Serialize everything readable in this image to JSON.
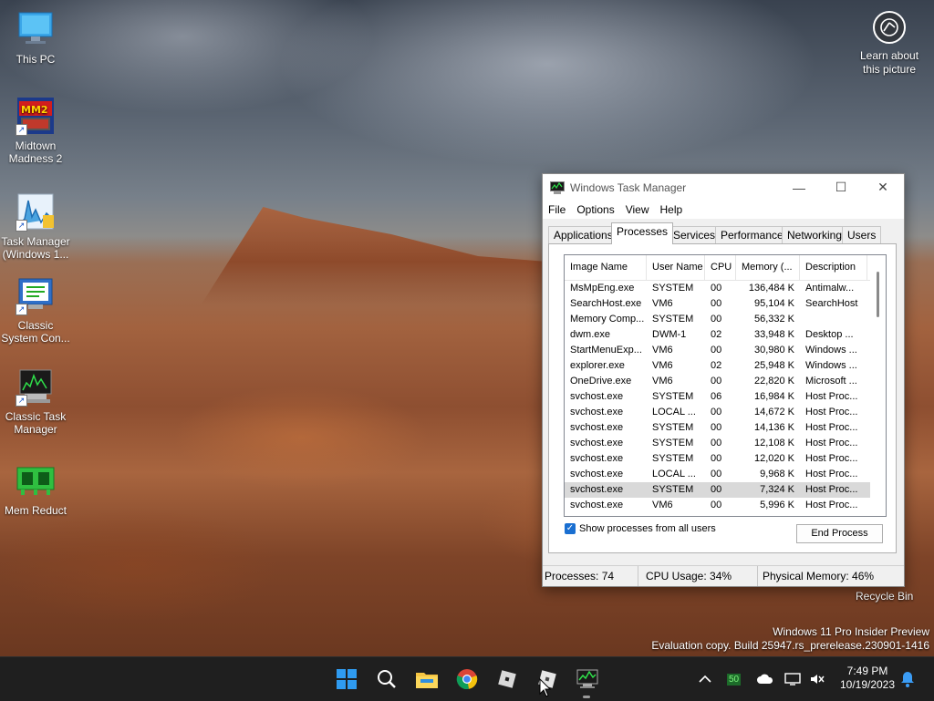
{
  "desktop": {
    "icons": [
      {
        "label": "This PC",
        "icon": "monitor-icon"
      },
      {
        "label": "Midtown Madness 2",
        "icon": "game-icon"
      },
      {
        "label": "Task Manager (Windows 1...",
        "icon": "chart-icon"
      },
      {
        "label": "Classic System Con...",
        "icon": "config-icon"
      },
      {
        "label": "Classic Task Manager",
        "icon": "taskmgr-icon"
      },
      {
        "label": "Mem Reduct",
        "icon": "memory-icon"
      }
    ],
    "learn_label": "Learn about this picture",
    "recycle_label": "Recycle Bin",
    "watermark_line1": "Windows 11 Pro Insider Preview",
    "watermark_line2": "Evaluation copy. Build 25947.rs_prerelease.230901-1416"
  },
  "task_manager": {
    "title": "Windows Task Manager",
    "controls": {
      "minimize": "—",
      "maximize": "☐",
      "close": "✕"
    },
    "menu": [
      "File",
      "Options",
      "View",
      "Help"
    ],
    "tabs": [
      "Applications",
      "Processes",
      "Services",
      "Performance",
      "Networking",
      "Users"
    ],
    "active_tab": "Processes",
    "columns": [
      "Image Name",
      "User Name",
      "CPU",
      "Memory (...",
      "Description"
    ],
    "rows": [
      [
        "MsMpEng.exe",
        "SYSTEM",
        "00",
        "136,484 K",
        "Antimalw..."
      ],
      [
        "SearchHost.exe",
        "VM6",
        "00",
        "95,104 K",
        "SearchHost"
      ],
      [
        "Memory Comp...",
        "SYSTEM",
        "00",
        "56,332 K",
        ""
      ],
      [
        "dwm.exe",
        "DWM-1",
        "02",
        "33,948 K",
        "Desktop ..."
      ],
      [
        "StartMenuExp...",
        "VM6",
        "00",
        "30,980 K",
        "Windows ..."
      ],
      [
        "explorer.exe",
        "VM6",
        "02",
        "25,948 K",
        "Windows ..."
      ],
      [
        "OneDrive.exe",
        "VM6",
        "00",
        "22,820 K",
        "Microsoft ..."
      ],
      [
        "svchost.exe",
        "SYSTEM",
        "06",
        "16,984 K",
        "Host Proc..."
      ],
      [
        "svchost.exe",
        "LOCAL ...",
        "00",
        "14,672 K",
        "Host Proc..."
      ],
      [
        "svchost.exe",
        "SYSTEM",
        "00",
        "14,136 K",
        "Host Proc..."
      ],
      [
        "svchost.exe",
        "SYSTEM",
        "00",
        "12,108 K",
        "Host Proc..."
      ],
      [
        "svchost.exe",
        "SYSTEM",
        "00",
        "12,020 K",
        "Host Proc..."
      ],
      [
        "svchost.exe",
        "LOCAL ...",
        "00",
        "9,968 K",
        "Host Proc..."
      ],
      [
        "svchost.exe",
        "SYSTEM",
        "00",
        "7,324 K",
        "Host Proc..."
      ],
      [
        "svchost.exe",
        "VM6",
        "00",
        "5,996 K",
        "Host Proc..."
      ]
    ],
    "selected_row": 13,
    "show_all_label": "Show processes from all users",
    "show_all_checked": true,
    "end_process_label": "End Process",
    "status": {
      "processes": "Processes: 74",
      "cpu": "CPU Usage: 34%",
      "memory": "Physical Memory: 46%"
    }
  },
  "taskbar": {
    "pinned": [
      "start-icon",
      "search-icon",
      "file-explorer-icon",
      "chrome-icon",
      "roblox-icon",
      "roblox-studio-icon",
      "task-manager-icon"
    ],
    "tray_badge": "50",
    "time": "7:49 PM",
    "date": "10/19/2023"
  }
}
